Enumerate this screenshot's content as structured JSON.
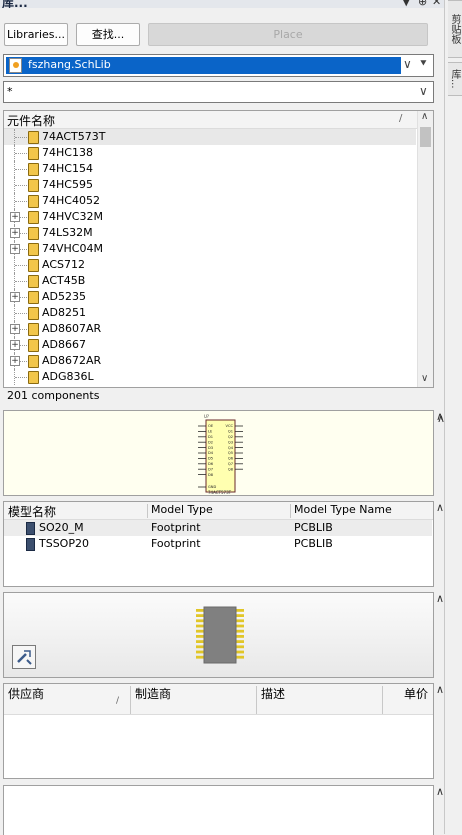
{
  "titlebar": {
    "title": "库...",
    "pin_icon": "pin-icon",
    "dropdown_icon": "triangle-down-icon",
    "close_icon": "close-icon"
  },
  "side_tabs": [
    "剪贴板",
    "库..."
  ],
  "toolbar": {
    "libraries_label": "Libraries...",
    "search_label": "查找...",
    "place_label": "Place"
  },
  "library_select": {
    "value": "fszhang.SchLib"
  },
  "filter": {
    "value": "*"
  },
  "components": {
    "column_header": "元件名称",
    "sort_glyph": "/",
    "items": [
      {
        "name": "74ACT573T",
        "expandable": false
      },
      {
        "name": "74HC138",
        "expandable": false
      },
      {
        "name": "74HC154",
        "expandable": false
      },
      {
        "name": "74HC595",
        "expandable": false
      },
      {
        "name": "74HC4052",
        "expandable": false
      },
      {
        "name": "74HVC32M",
        "expandable": true
      },
      {
        "name": "74LS32M",
        "expandable": true
      },
      {
        "name": "74VHC04M",
        "expandable": true
      },
      {
        "name": "ACS712",
        "expandable": false
      },
      {
        "name": "ACT45B",
        "expandable": false
      },
      {
        "name": "AD5235",
        "expandable": true
      },
      {
        "name": "AD8251",
        "expandable": false
      },
      {
        "name": "AD8607AR",
        "expandable": true
      },
      {
        "name": "AD8667",
        "expandable": true
      },
      {
        "name": "AD8672AR",
        "expandable": true
      },
      {
        "name": "ADG836L",
        "expandable": false
      }
    ],
    "count_text": "201 components"
  },
  "schematic_preview": {
    "ref": "U?",
    "part": "74ACT573T",
    "left_pins": [
      "OE",
      "LE",
      "D1",
      "D2",
      "D3",
      "D4",
      "D5",
      "D6",
      "D7",
      "D8",
      "GND"
    ],
    "right_pins": [
      "VCC",
      "Q1",
      "Q2",
      "Q3",
      "Q4",
      "Q5",
      "Q6",
      "Q7",
      "Q8"
    ]
  },
  "models": {
    "headers": [
      "模型名称",
      "Model Type",
      "Model Type Name"
    ],
    "rows": [
      {
        "name": "SO20_M",
        "type": "Footprint",
        "type_name": "PCBLIB"
      },
      {
        "name": "TSSOP20",
        "type": "Footprint",
        "type_name": "PCBLIB"
      }
    ]
  },
  "footprint_preview": {
    "tool_icon": "pcb-3d-view-icon"
  },
  "suppliers": {
    "headers": [
      "供应商",
      "制造商",
      "描述",
      "单价"
    ],
    "sort_glyph": "/"
  },
  "colors": {
    "selection": "#0a64c8",
    "component_icon": "#f2c64a",
    "preview_bg": "#fffff0",
    "chip_body": "#808080",
    "chip_pad": "#e1c628"
  }
}
